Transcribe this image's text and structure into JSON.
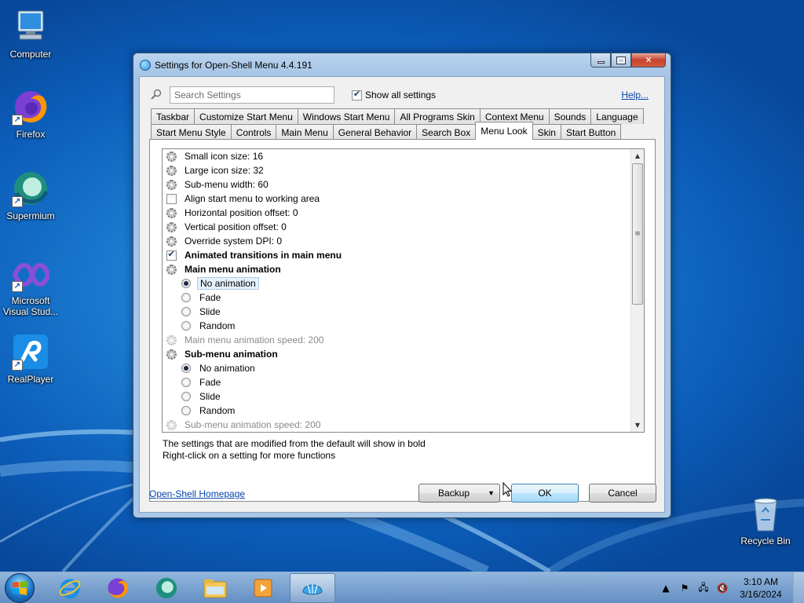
{
  "desktop": {
    "icons": [
      {
        "label": "Computer",
        "icon": "computer-icon"
      },
      {
        "label": "Firefox",
        "icon": "firefox-icon"
      },
      {
        "label": "Supermium",
        "icon": "supermium-icon"
      },
      {
        "label": "Microsoft Visual Stud...",
        "icon": "visual-studio-icon"
      },
      {
        "label": "RealPlayer",
        "icon": "realplayer-icon"
      },
      {
        "label": "Recycle Bin",
        "icon": "recycle-bin-icon"
      }
    ]
  },
  "dialog": {
    "title": "Settings for Open-Shell Menu 4.4.191",
    "search_placeholder": "Search Settings",
    "show_all_label": "Show all settings",
    "show_all_checked": true,
    "help_label": "Help...",
    "tabs_row1": [
      "Taskbar",
      "Customize Start Menu",
      "Windows Start Menu",
      "All Programs Skin",
      "Context Menu",
      "Sounds",
      "Language"
    ],
    "tabs_row2": [
      "Start Menu Style",
      "Controls",
      "Main Menu",
      "General Behavior",
      "Search Box",
      "Menu Look",
      "Skin",
      "Start Button"
    ],
    "active_tab": "Menu Look",
    "settings": [
      {
        "label": "Small icon size: 16",
        "kind": "gear"
      },
      {
        "label": "Large icon size: 32",
        "kind": "gear"
      },
      {
        "label": "Sub-menu width: 60",
        "kind": "gear"
      },
      {
        "label": "Align start menu to working area",
        "kind": "check",
        "checked": false
      },
      {
        "label": "Horizontal position offset: 0",
        "kind": "gear"
      },
      {
        "label": "Vertical position offset: 0",
        "kind": "gear"
      },
      {
        "label": "Override system DPI: 0",
        "kind": "gear"
      },
      {
        "label": "Animated transitions in main menu",
        "kind": "check",
        "checked": true,
        "bold": true
      },
      {
        "label": "Main menu animation",
        "kind": "gear",
        "bold": true
      },
      {
        "label": "No animation",
        "kind": "radio",
        "checked": true,
        "selected": true
      },
      {
        "label": "Fade",
        "kind": "radio",
        "checked": false
      },
      {
        "label": "Slide",
        "kind": "radio",
        "checked": false
      },
      {
        "label": "Random",
        "kind": "radio",
        "checked": false
      },
      {
        "label": "Main menu animation speed: 200",
        "kind": "gear",
        "dim": true
      },
      {
        "label": "Sub-menu animation",
        "kind": "gear",
        "bold": true
      },
      {
        "label": "No animation",
        "kind": "radio",
        "checked": true
      },
      {
        "label": "Fade",
        "kind": "radio",
        "checked": false
      },
      {
        "label": "Slide",
        "kind": "radio",
        "checked": false
      },
      {
        "label": "Random",
        "kind": "radio",
        "checked": false
      },
      {
        "label": "Sub-menu animation speed: 200",
        "kind": "gear",
        "dim": true
      }
    ],
    "note_line1": "The settings that are modified from the default will show in bold",
    "note_line2": "Right-click on a setting for more functions",
    "homepage_link": "Open-Shell Homepage",
    "backup_label": "Backup",
    "ok_label": "OK",
    "cancel_label": "Cancel"
  },
  "taskbar": {
    "apps": [
      "internet-explorer-icon",
      "firefox-icon",
      "supermium-icon",
      "file-explorer-icon",
      "media-player-icon",
      "open-shell-icon"
    ],
    "active_app": "open-shell-icon",
    "time": "3:10 AM",
    "date": "3/16/2024"
  }
}
